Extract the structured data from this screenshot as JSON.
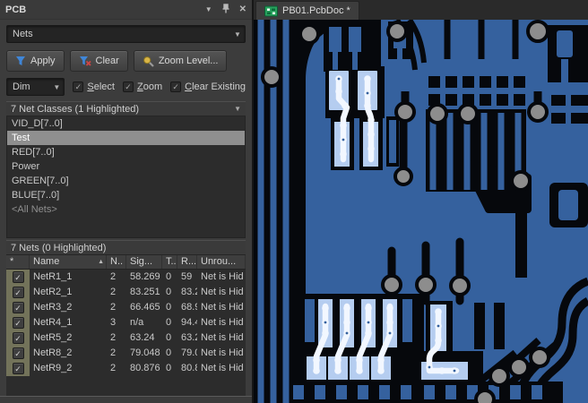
{
  "panel": {
    "title": "PCB",
    "header_icons": {
      "dropdown": "▼",
      "pin": "pin",
      "close": "✕"
    },
    "mode_select": {
      "value": "Nets"
    },
    "toolbar": {
      "apply": "Apply",
      "clear": "Clear",
      "zoom_level": "Zoom Level...",
      "icon_colors": {
        "funnel_blue": "#3f86d8",
        "clear_x": "#cf4444",
        "lens_gold": "#d9b547"
      }
    },
    "options": {
      "dim": "Dim",
      "select": "Select",
      "zoom": "Zoom",
      "clear_existing": "Clear Existing"
    },
    "net_classes": {
      "header": "7 Net Classes (1 Highlighted)",
      "items": [
        {
          "label": "VID_D[7..0]",
          "selected": false
        },
        {
          "label": "Test",
          "selected": true
        },
        {
          "label": "RED[7..0]",
          "selected": false
        },
        {
          "label": "Power",
          "selected": false
        },
        {
          "label": "GREEN[7..0]",
          "selected": false
        },
        {
          "label": "BLUE[7..0]",
          "selected": false
        },
        {
          "label": "<All Nets>",
          "selected": false,
          "muted": true
        }
      ]
    },
    "nets": {
      "header": "7 Nets (0 Highlighted)",
      "columns": [
        "*",
        "Name",
        "N..",
        "Sig...",
        "T...",
        "R...",
        "Unrou..."
      ],
      "sort_column": "Name",
      "rows": [
        {
          "checked": true,
          "cells": [
            "NetR1_1",
            "2",
            "58.269",
            "0",
            "59",
            "Net is Hid"
          ]
        },
        {
          "checked": true,
          "cells": [
            "NetR2_1",
            "2",
            "83.251",
            "0",
            "83.2",
            "Net is Hid"
          ]
        },
        {
          "checked": true,
          "cells": [
            "NetR3_2",
            "2",
            "66.465",
            "0",
            "68.9",
            "Net is Hid"
          ]
        },
        {
          "checked": true,
          "cells": [
            "NetR4_1",
            "3",
            "n/a",
            "0",
            "94.4",
            "Net is Hid"
          ]
        },
        {
          "checked": true,
          "cells": [
            "NetR5_2",
            "2",
            "63.24",
            "0",
            "63.2",
            "Net is Hid"
          ]
        },
        {
          "checked": true,
          "cells": [
            "NetR8_2",
            "2",
            "79.048",
            "0",
            "79.0",
            "Net is Hid"
          ]
        },
        {
          "checked": true,
          "cells": [
            "NetR9_2",
            "2",
            "80.876",
            "0",
            "80.8",
            "Net is Hid"
          ]
        }
      ]
    }
  },
  "tabbar": {
    "active_tab": "PB01.PcbDoc *",
    "icon_colors": {
      "doc_green": "#28a15d",
      "doc_green_dark": "#0d6b3a"
    }
  },
  "pcb_view": {
    "colors": {
      "copper_pour": "#35619e",
      "background": "#06080c",
      "via": "#8d8d8d",
      "highlight_pad": "#b5cdf0",
      "highlight_trace": "#f2f7ff"
    }
  }
}
